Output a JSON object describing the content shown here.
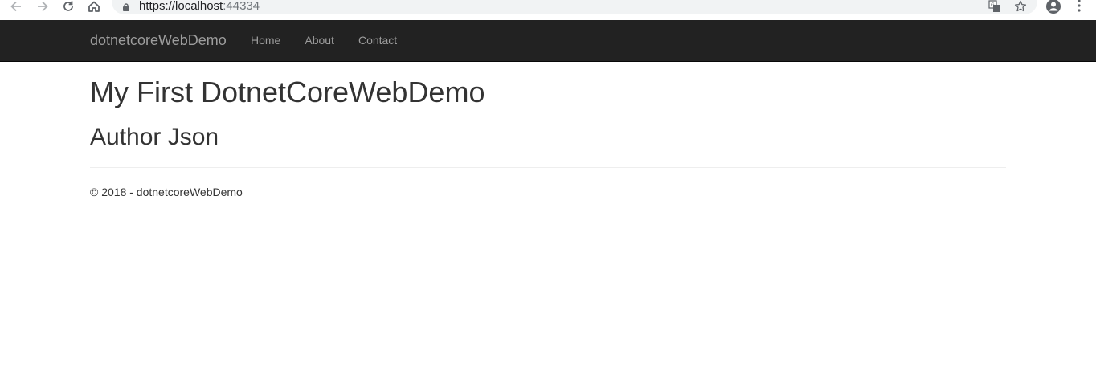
{
  "browser": {
    "url_host": "https://localhost",
    "url_port": ":44334",
    "back_icon": "arrow-left-icon",
    "forward_icon": "arrow-right-icon",
    "reload_icon": "reload-icon",
    "home_icon": "home-icon",
    "lock_icon": "lock-icon",
    "translate_icon": "translate-icon",
    "bookmark_icon": "star-icon",
    "profile_icon": "account-circle-icon",
    "menu_icon": "kebab-menu-icon"
  },
  "navbar": {
    "brand": "dotnetcoreWebDemo",
    "links": [
      {
        "label": "Home"
      },
      {
        "label": "About"
      },
      {
        "label": "Contact"
      }
    ],
    "background": "#222222",
    "link_color": "#9d9d9d"
  },
  "main": {
    "heading": "My First DotnetCoreWebDemo",
    "subheading": "Author Json"
  },
  "footer": {
    "text": "© 2018 - dotnetcoreWebDemo"
  }
}
